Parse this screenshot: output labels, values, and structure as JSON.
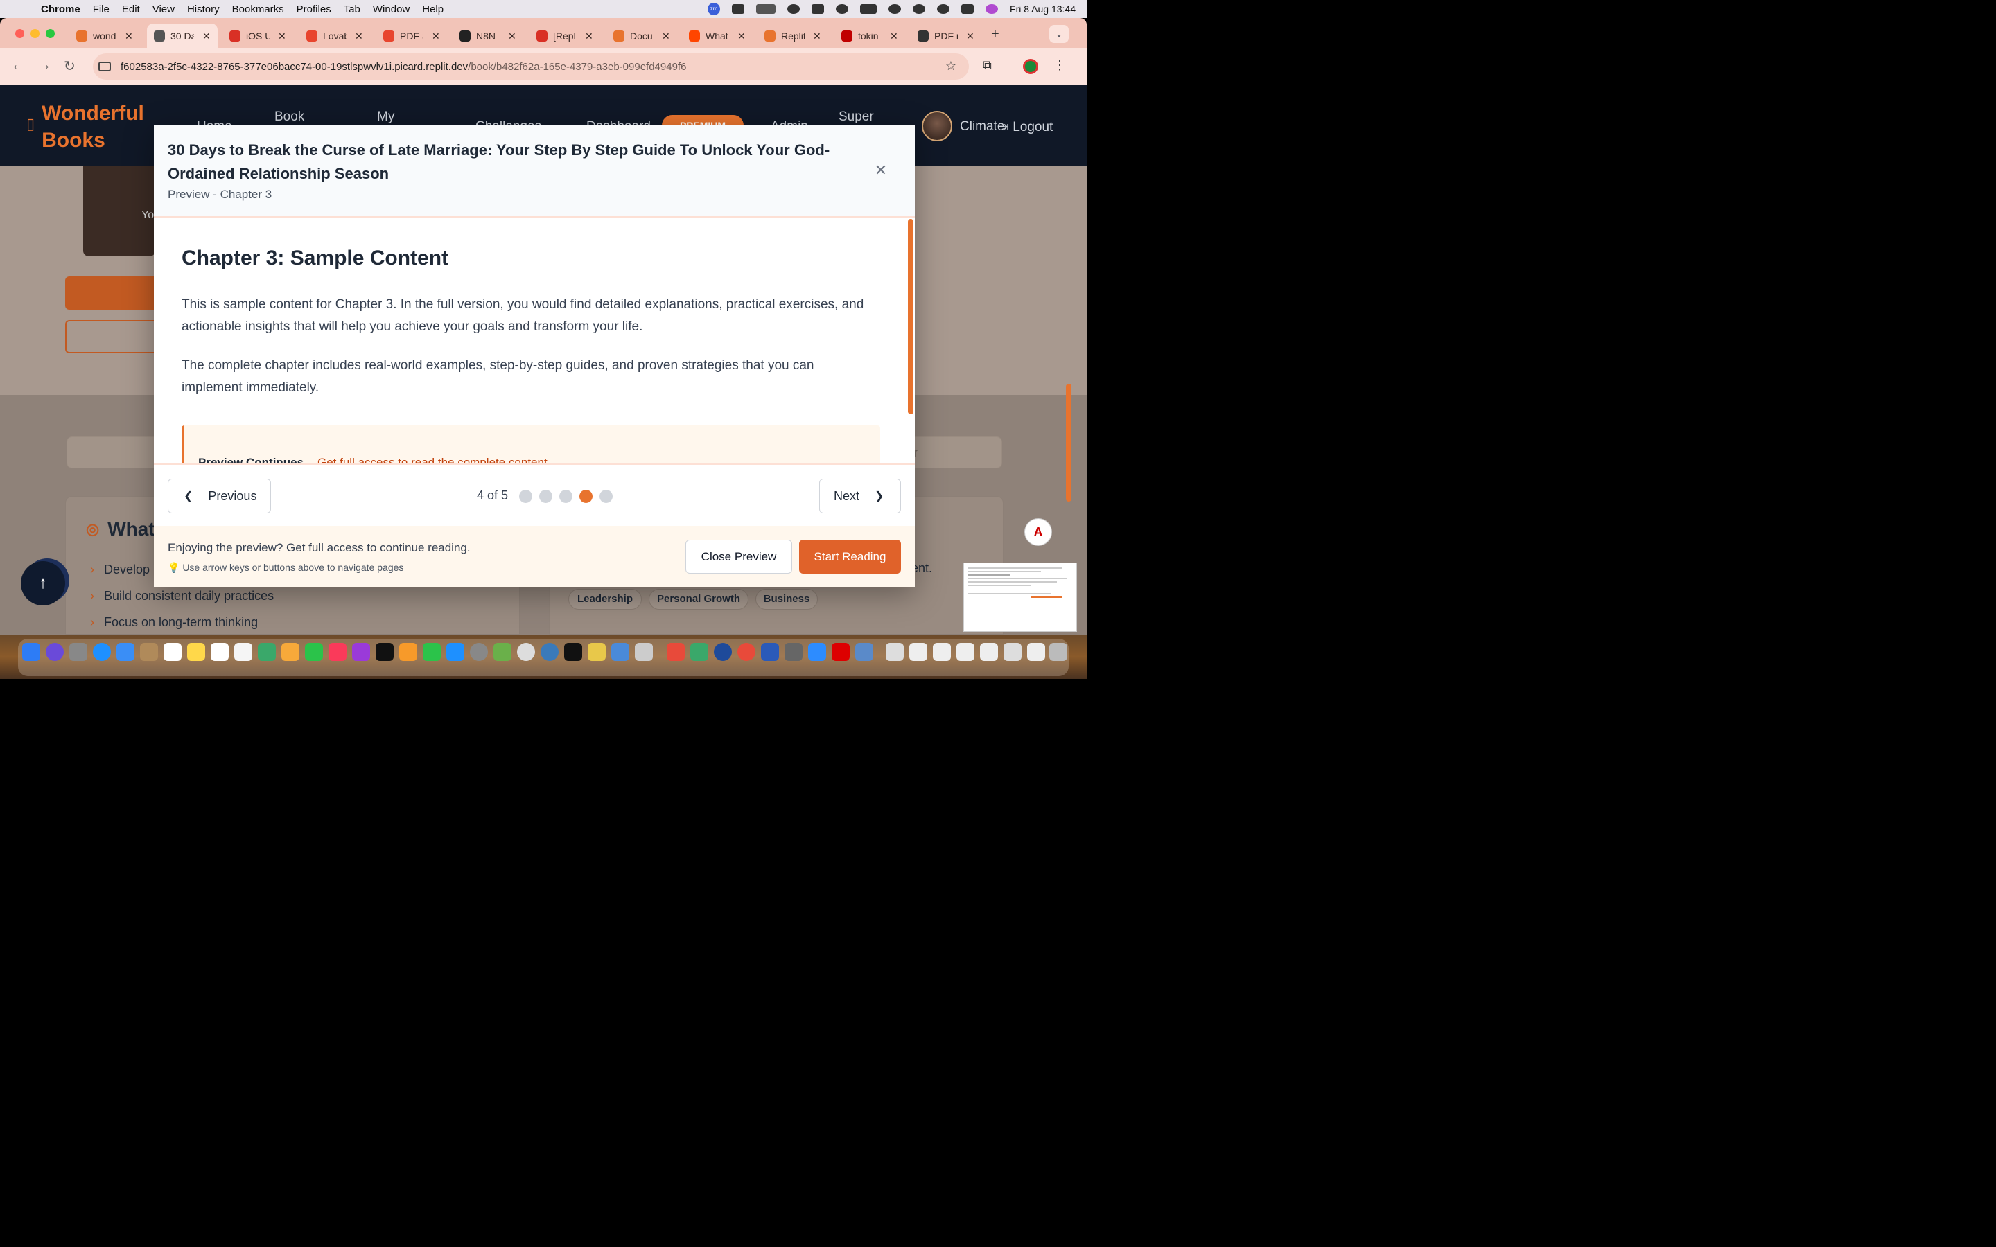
{
  "menubar": {
    "app": "Chrome",
    "items": [
      "File",
      "Edit",
      "View",
      "History",
      "Bookmarks",
      "Profiles",
      "Tab",
      "Window",
      "Help"
    ],
    "datetime": "Fri 8 Aug  13:44",
    "zoom_badge": "zm"
  },
  "tabs": [
    {
      "title": "wond",
      "favicon_color": "#e8732e"
    },
    {
      "title": "30 Da",
      "favicon_color": "#555555",
      "active": true
    },
    {
      "title": "iOS U",
      "favicon_color": "#d93025"
    },
    {
      "title": "Lovab",
      "favicon_color": "#e8452e"
    },
    {
      "title": "PDF S",
      "favicon_color": "#e8452e"
    },
    {
      "title": "N8N",
      "favicon_color": "#222222"
    },
    {
      "title": "[Repl",
      "favicon_color": "#d93025"
    },
    {
      "title": "Docu",
      "favicon_color": "#e8732e"
    },
    {
      "title": "What",
      "favicon_color": "#ff4500"
    },
    {
      "title": "Replit",
      "favicon_color": "#e8732e"
    },
    {
      "title": "tokin",
      "favicon_color": "#c00000"
    },
    {
      "title": "PDF r",
      "favicon_color": "#333333"
    }
  ],
  "address": {
    "host": "f602583a-2f5c-4322-8765-377e06bacc74-00-19stlspwvlv1i.picard.replit.dev",
    "path": "/book/b482f62a-165e-4379-a3eb-099efd4949f6"
  },
  "site": {
    "logo": "Wonderful Books",
    "nav": {
      "home": "Home",
      "book": "Book",
      "my": "My",
      "challenges": "Challenges",
      "dashboard": "Dashboard",
      "premium": "PREMIUM",
      "admin": "Admin",
      "super": "Super"
    },
    "username": "Climate",
    "logout": "Logout"
  },
  "background": {
    "cover_text": "Yo",
    "section_title": "What",
    "goals": [
      "Develop",
      "Build consistent daily practices",
      "Focus on long-term thinking"
    ],
    "right_text": "ment.",
    "search_hint": "r",
    "tags": [
      "Leadership",
      "Personal Growth",
      "Business"
    ]
  },
  "modal": {
    "title": "30 Days to Break the Curse of Late Marriage: Your Step By Step Guide To Unlock Your God-Ordained Relationship Season",
    "subtitle": "Preview - Chapter 3",
    "chapter_heading": "Chapter 3: Sample Content",
    "paragraph1": "This is sample content for Chapter 3. In the full version, you would find detailed explanations, practical exercises, and actionable insights that will help you achieve your goals and transform your life.",
    "paragraph2": "The complete chapter includes real-world examples, step-by-step guides, and proven strategies that you can implement immediately.",
    "notice_title": "Preview Continues",
    "notice_text": "Get full access to read the complete content",
    "previous_label": "Previous",
    "next_label": "Next",
    "page_indicator": "4 of 5",
    "current_page": 4,
    "total_pages": 5,
    "footer_text": "Enjoying the preview? Get full access to continue reading.",
    "footer_hint": "💡 Use arrow keys or buttons above to navigate pages",
    "close_label": "Close Preview",
    "start_label": "Start Reading"
  },
  "colors": {
    "accent": "#e8732e",
    "nav_bg": "#101827"
  }
}
